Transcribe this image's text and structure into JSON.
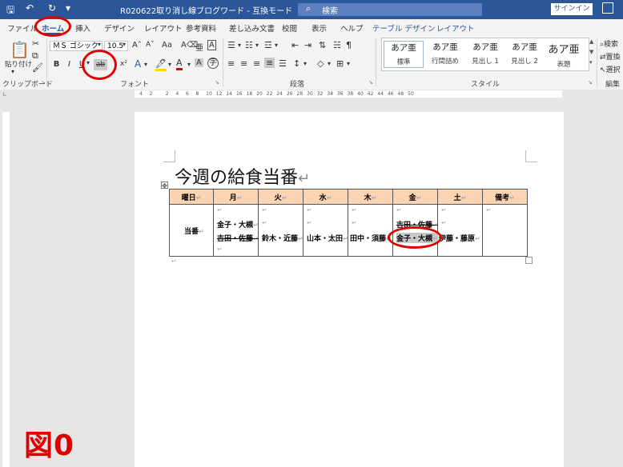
{
  "window": {
    "title": "R020622取り消し線ブログワード - 互換モード",
    "search_label": "検索",
    "signin_label": "サインイン"
  },
  "tabs": [
    "ファイル",
    "ホーム",
    "挿入",
    "デザイン",
    "レイアウト",
    "参考資料",
    "差し込み文書",
    "校閲",
    "表示",
    "ヘルプ",
    "テーブル デザイン",
    "レイアウト"
  ],
  "active_tab": "ホーム",
  "ribbon": {
    "clipboard": {
      "paste_label": "貼り付け",
      "group_label": "クリップボード"
    },
    "font": {
      "font_name": "ＭＳ ゴシック",
      "font_size": "10.5",
      "bold": "B",
      "italic": "I",
      "underline": "U",
      "strikethrough": "ab",
      "superscript": "x²",
      "group_label": "フォント"
    },
    "paragraph": {
      "group_label": "段落"
    },
    "styles": {
      "items": [
        {
          "preview": "あア亜",
          "name": "標準"
        },
        {
          "preview": "あア亜",
          "name": "行間詰め"
        },
        {
          "preview": "あア亜",
          "name": "見出し 1"
        },
        {
          "preview": "あア亜",
          "name": "見出し 2"
        },
        {
          "preview": "あア亜",
          "name": "表題"
        }
      ],
      "group_label": "スタイル"
    },
    "editing": {
      "search": "検索",
      "replace": "置換",
      "select": "選択",
      "group_label": "編集"
    }
  },
  "ruler_ticks": [
    "4",
    "2",
    "2",
    "4",
    "6",
    "8",
    "10",
    "12",
    "14",
    "16",
    "18",
    "20",
    "22",
    "24",
    "26",
    "28",
    "30",
    "32",
    "34",
    "36",
    "38",
    "40",
    "42",
    "44",
    "46",
    "48",
    "50"
  ],
  "document": {
    "heading": "今週の給食当番",
    "table": {
      "headers": [
        "曜日",
        "月",
        "火",
        "水",
        "木",
        "金",
        "土",
        "備考"
      ],
      "row_label": "当番",
      "mon": {
        "line1": "金子・大槻",
        "line2": "吉田・佐藤"
      },
      "tue": "鈴木・近藤",
      "wed": "山本・太田",
      "thu": "田中・須藤",
      "fri": {
        "line1": "吉田・佐藤",
        "line2": "金子・大槻"
      },
      "sat": "伊藤・藤原"
    }
  },
  "figure_label": "図0"
}
